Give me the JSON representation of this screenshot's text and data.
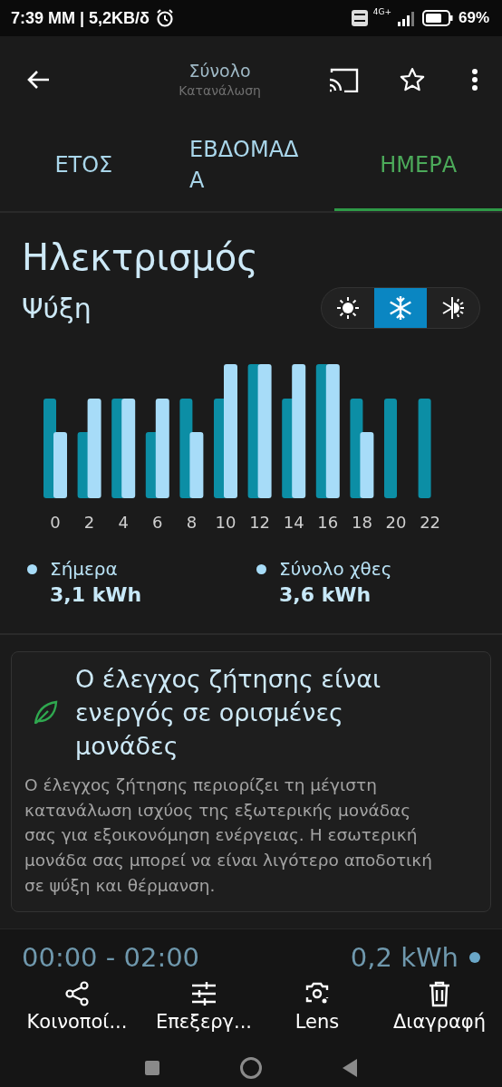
{
  "status_bar": {
    "time": "7:39 ΜΜ | 5,2KB/δ",
    "network": "4G+",
    "battery": "69%"
  },
  "app_bar": {
    "title": "Σύνολο",
    "subtitle": "Κατανάλωση"
  },
  "tabs": [
    {
      "label": "ΕΤΟΣ",
      "selected": false
    },
    {
      "label": "ΕΒΔΟΜΑΔΑ",
      "selected": false
    },
    {
      "label": "ΗΜΕΡΑ",
      "selected": true
    }
  ],
  "section_title": "Ηλεκτρισμός",
  "mode": {
    "label": "Ψύξη",
    "options": [
      {
        "kind": "heat",
        "selected": false
      },
      {
        "kind": "cool",
        "selected": true
      },
      {
        "kind": "auto",
        "selected": false
      }
    ]
  },
  "hour_labels": [
    "0",
    "2",
    "4",
    "6",
    "8",
    "10",
    "12",
    "14",
    "16",
    "18",
    "20",
    "22"
  ],
  "legend": [
    {
      "label": "Σήμερα",
      "value": "3,1 kWh"
    },
    {
      "label": "Σύνολο χθες",
      "value": "3,6 kWh"
    }
  ],
  "notice": {
    "title": "Ο έλεγχος ζήτησης είναι ενεργός σε ορισμένες μονάδες",
    "body": "Ο έλεγχος ζήτησης περιορίζει τη μέγιστη κατανάλωση ισχύος της εξωτερικής μονάδας σας για εξοικονόμηση ενέργειας. Η εσωτερική μονάδα σας μπορεί να είναι λιγότερο αποδοτική σε ψύξη και θέρμανση."
  },
  "usage_row": {
    "period": "00:00 - 02:00",
    "value": "0,2 kWh"
  },
  "share_actions": [
    {
      "kind": "share",
      "label": "Κοινοποί..."
    },
    {
      "kind": "edit",
      "label": "Επεξεργ..."
    },
    {
      "kind": "lens",
      "label": "Lens"
    },
    {
      "kind": "delete",
      "label": "Διαγραφή"
    }
  ]
}
